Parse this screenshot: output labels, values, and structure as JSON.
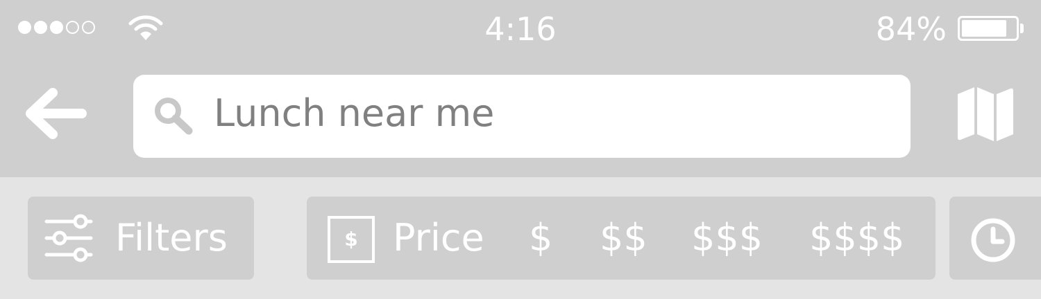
{
  "status_bar": {
    "time": "4:16",
    "battery_percent": "84%",
    "battery_level": 0.84,
    "signal_bars_filled": 3,
    "signal_bars_total": 5,
    "wifi_icon": "wifi-icon"
  },
  "nav": {
    "back_icon": "arrow-left-icon",
    "search_icon": "search-icon",
    "search_query": "Lunch near me",
    "map_icon": "map-icon"
  },
  "filter_bar": {
    "filters_icon": "sliders-icon",
    "filters_label": "Filters",
    "price_icon_glyph": "$",
    "price_label": "Price",
    "price_options": [
      "$",
      "$$",
      "$$$",
      "$$$$"
    ],
    "hours_icon": "clock-icon"
  },
  "colors": {
    "header_bg": "#cfcfcf",
    "filter_bar_bg": "#e4e4e4",
    "chip_bg": "#cfcfcf",
    "search_bg": "#ffffff",
    "search_text": "#808080",
    "foreground": "#ffffff"
  }
}
